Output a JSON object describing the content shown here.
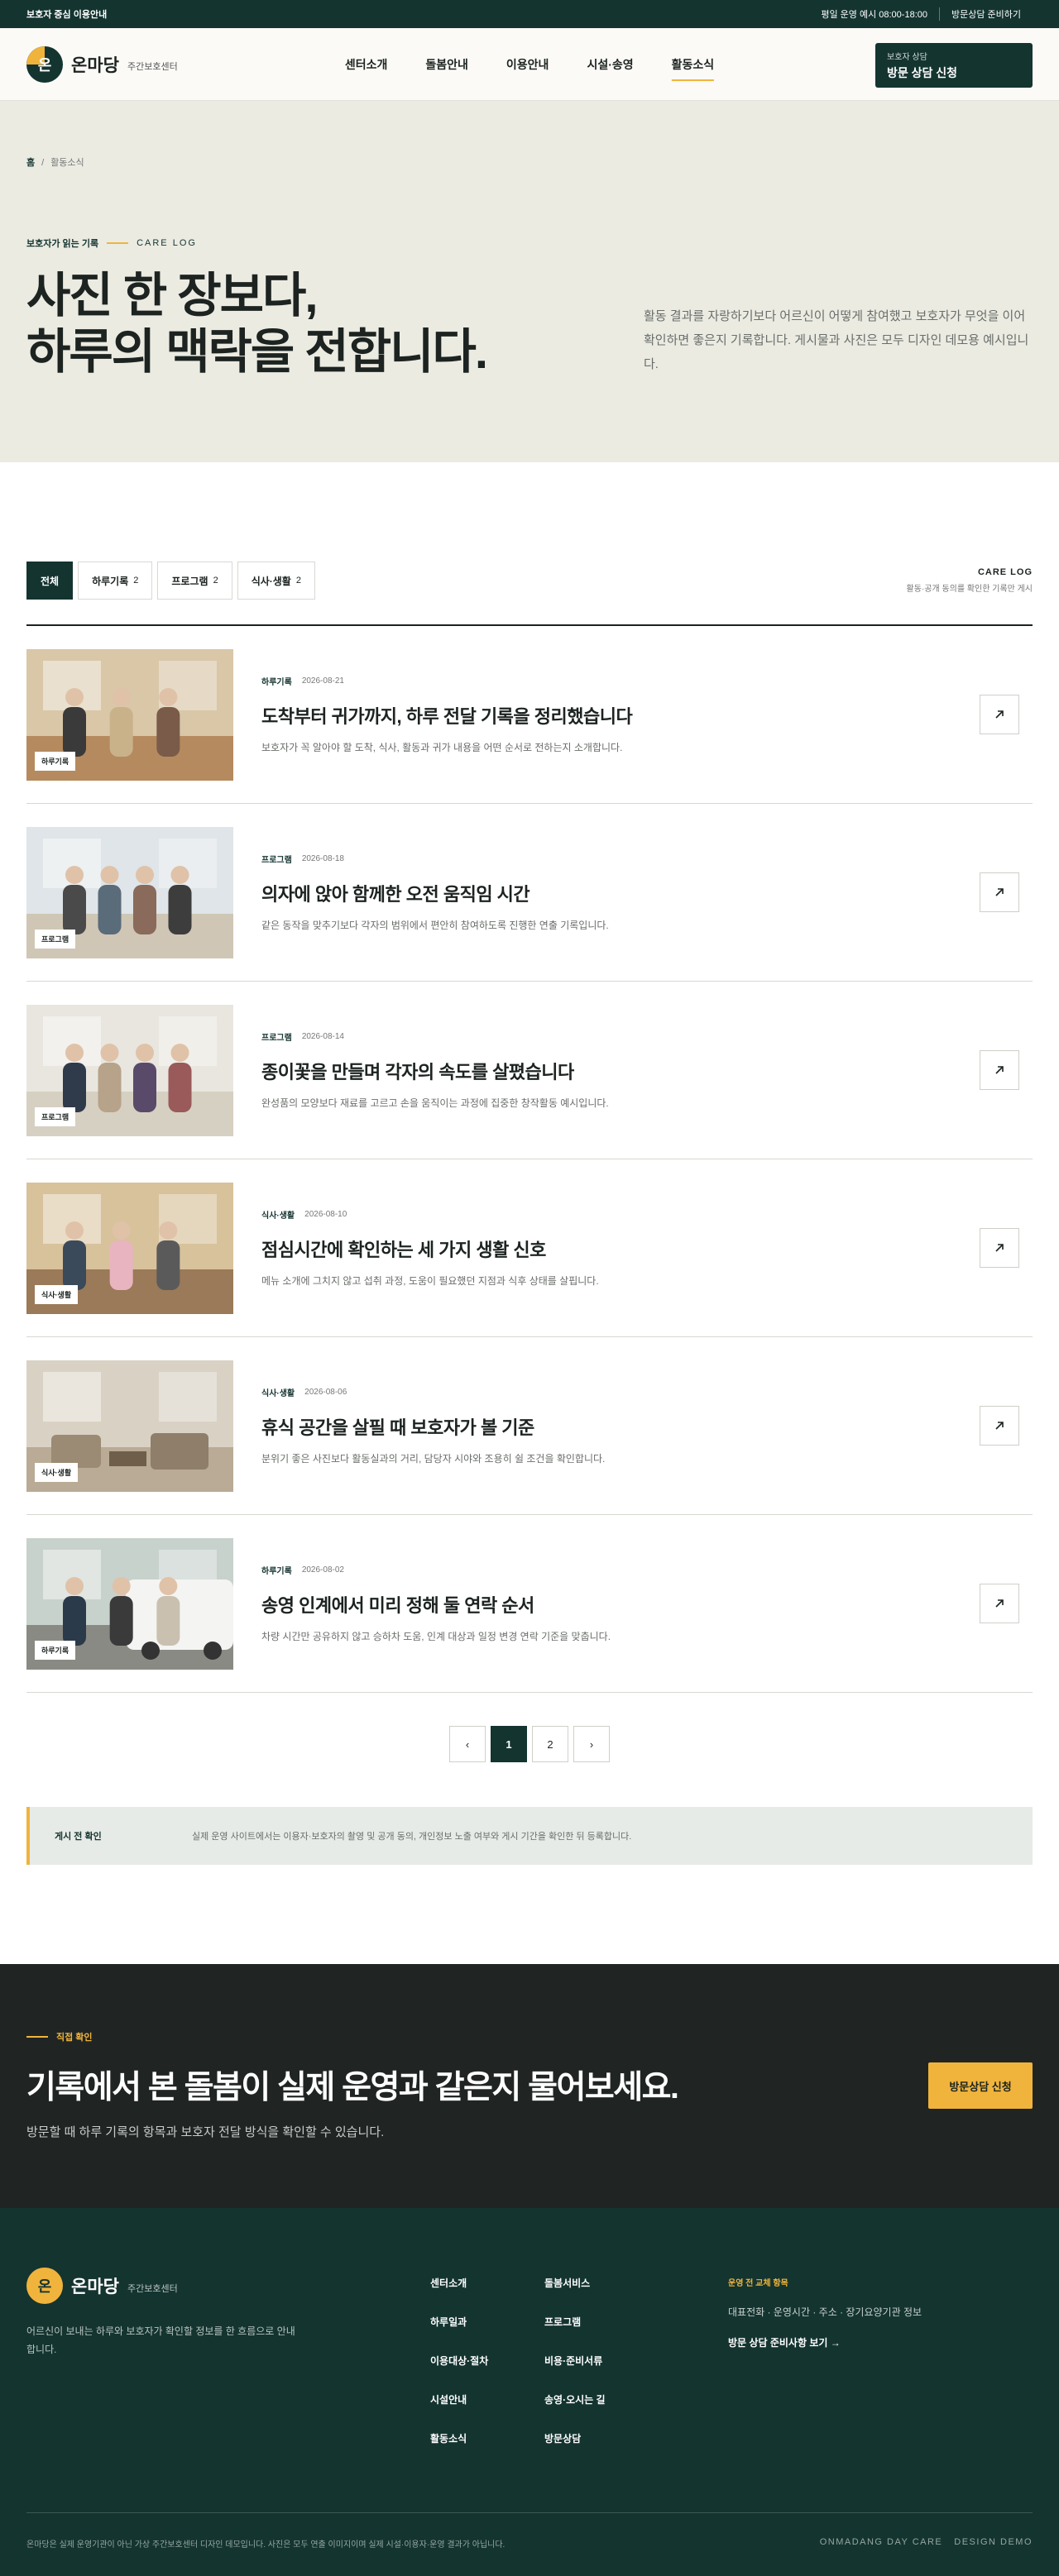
{
  "topbar": {
    "left": "보호자 중심 이용안내",
    "hours": "평일 운영 예시 08:00-18:00",
    "prep": "방문상담 준비하기"
  },
  "header": {
    "logo_mark": "온",
    "logo_name": "온마당",
    "logo_sub": "주간보호센터",
    "nav": [
      "센터소개",
      "돌봄안내",
      "이용안내",
      "시설·송영",
      "활동소식"
    ],
    "active_nav": 4,
    "cta_small": "보호자 상담",
    "cta_big": "방문 상담 신청"
  },
  "hero": {
    "crumb_home": "홈",
    "crumb_sep": "/",
    "crumb_current": "활동소식",
    "eyebrow": "보호자가 읽는 기록",
    "eyebrow_en": "CARE LOG",
    "title_line1": "사진 한 장보다,",
    "title_line2": "하루의 맥락을 전합니다.",
    "desc": "활동 결과를 자랑하기보다 어르신이 어떻게 참여했고 보호자가 무엇을 이어 확인하면 좋은지 기록합니다. 게시물과 사진은 모두 디자인 데모용 예시입니다."
  },
  "filters": {
    "chips": [
      {
        "label": "전체",
        "count": ""
      },
      {
        "label": "하루기록",
        "count": "2"
      },
      {
        "label": "프로그램",
        "count": "2"
      },
      {
        "label": "식사·생활",
        "count": "2"
      }
    ],
    "active": 0,
    "side_title": "CARE LOG",
    "side_sub": "활동·공개 동의를 확인한 기록만 게시"
  },
  "posts": [
    {
      "cat": "하루기록",
      "date": "2026-08-21",
      "title": "도착부터 귀가까지, 하루 전달 기록을 정리했습니다",
      "excerpt": "보호자가 꼭 알아야 할 도착, 식사, 활동과 귀가 내용을 어떤 순서로 전하는지 소개합니다.",
      "tag": "하루기록"
    },
    {
      "cat": "프로그램",
      "date": "2026-08-18",
      "title": "의자에 앉아 함께한 오전 움직임 시간",
      "excerpt": "같은 동작을 맞추기보다 각자의 범위에서 편안히 참여하도록 진행한 연출 기록입니다.",
      "tag": "프로그램"
    },
    {
      "cat": "프로그램",
      "date": "2026-08-14",
      "title": "종이꽃을 만들며 각자의 속도를 살폈습니다",
      "excerpt": "완성품의 모양보다 재료를 고르고 손을 움직이는 과정에 집중한 창작활동 예시입니다.",
      "tag": "프로그램"
    },
    {
      "cat": "식사·생활",
      "date": "2026-08-10",
      "title": "점심시간에 확인하는 세 가지 생활 신호",
      "excerpt": "메뉴 소개에 그치지 않고 섭취 과정, 도움이 필요했던 지점과 식후 상태를 살핍니다.",
      "tag": "식사·생활"
    },
    {
      "cat": "식사·생활",
      "date": "2026-08-06",
      "title": "휴식 공간을 살필 때 보호자가 볼 기준",
      "excerpt": "분위기 좋은 사진보다 활동실과의 거리, 담당자 시야와 조용히 쉴 조건을 확인합니다.",
      "tag": "식사·생활"
    },
    {
      "cat": "하루기록",
      "date": "2026-08-02",
      "title": "송영 인계에서 미리 정해 둘 연락 순서",
      "excerpt": "차량 시간만 공유하지 않고 승하차 도움, 인계 대상과 일정 변경 연락 기준을 맞춥니다.",
      "tag": "하루기록"
    }
  ],
  "pager": {
    "prev": "‹",
    "pages": [
      "1",
      "2"
    ],
    "active": 0,
    "next": "›"
  },
  "notice": {
    "head": "게시 전 확인",
    "body": "실제 운영 사이트에서는 이용자·보호자의 촬영 및 공개 동의, 개인정보 노출 여부와 게시 기간을 확인한 뒤 등록합니다."
  },
  "band": {
    "eyebrow": "직접 확인",
    "title": "기록에서 본 돌봄이 실제 운영과 같은지 물어보세요.",
    "desc": "방문할 때 하루 기록의 항목과 보호자 전달 방식을 확인할 수 있습니다.",
    "button": "방문상담 신청"
  },
  "footer": {
    "logo_mark": "온",
    "logo_name": "온마당",
    "logo_sub": "주간보호센터",
    "desc": "어르신이 보내는 하루와 보호자가 확인할 정보를 한 흐름으로 안내합니다.",
    "links": [
      "센터소개",
      "돌봄서비스",
      "하루일과",
      "프로그램",
      "이용대상·절차",
      "비용·준비서류",
      "시설안내",
      "송영·오시는 길",
      "활동소식",
      "방문상담"
    ],
    "info_head": "운영 전 교체 항목",
    "info_text": "대표전화 · 운영시간 · 주소 · 장기요양기관 정보",
    "info_link": "방문 상담 준비사항 보기 →",
    "legal": "온마당은 실제 운영기관이 아닌 가상 주간보호센터 디자인 데모입니다. 사진은 모두 연출 이미지이며 실제 시설·이용자·운영 결과가 아닙니다.",
    "brand_1": "ONMADANG DAY CARE",
    "brand_2": "DESIGN DEMO"
  },
  "colors": {
    "primary": "#143430",
    "accent": "#f0b43c",
    "hero_bg": "#ebebe2",
    "band_bg": "#202524"
  }
}
